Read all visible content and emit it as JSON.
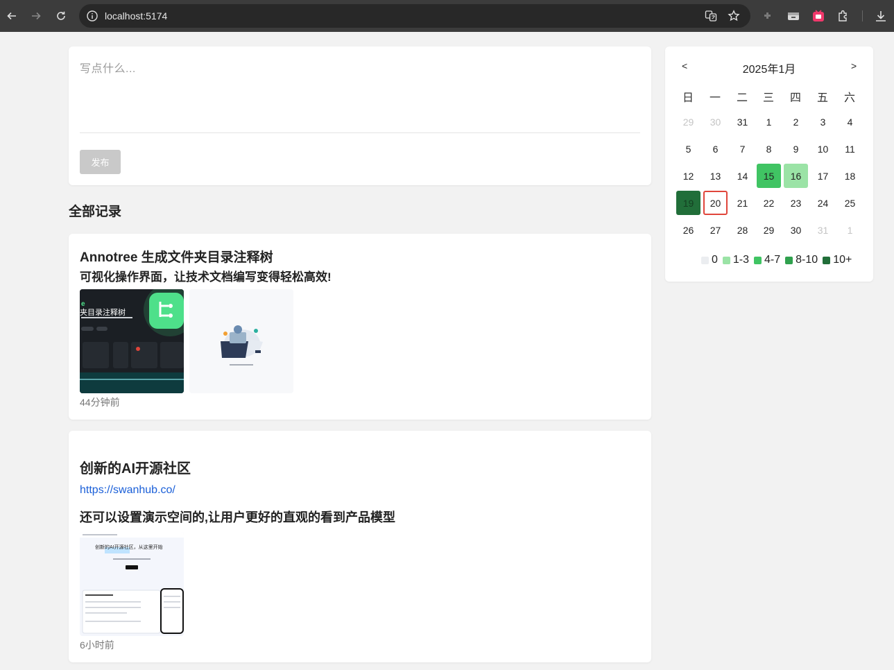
{
  "browser": {
    "url": "localhost:5174"
  },
  "composer": {
    "placeholder": "写点什么...",
    "publish_label": "发布"
  },
  "feed": {
    "section_title": "全部记录",
    "posts": [
      {
        "title": "Annotree 生成文件夹目录注释树",
        "subtitle": "可视化操作界面，让技术文档编写变得轻松高效!",
        "time": "44分钟前",
        "thumb1_text": "夹目录注释树"
      },
      {
        "title": "创新的AI开源社区",
        "link": "https://swanhub.co/",
        "subtitle": "还可以设置演示空间的,让用户更好的直观的看到产品模型",
        "time": "6小时前",
        "thumb_text": "创新的AI开源社区，从这里开始"
      }
    ]
  },
  "calendar": {
    "title": "2025年1月",
    "prev": "<",
    "next": ">",
    "weekdays": [
      "日",
      "一",
      "二",
      "三",
      "四",
      "五",
      "六"
    ],
    "weeks": [
      [
        {
          "d": "29",
          "o": true
        },
        {
          "d": "30",
          "o": true
        },
        {
          "d": "31"
        },
        {
          "d": "1"
        },
        {
          "d": "2"
        },
        {
          "d": "3"
        },
        {
          "d": "4"
        }
      ],
      [
        {
          "d": "5"
        },
        {
          "d": "6"
        },
        {
          "d": "7"
        },
        {
          "d": "8"
        },
        {
          "d": "9"
        },
        {
          "d": "10"
        },
        {
          "d": "11"
        }
      ],
      [
        {
          "d": "12"
        },
        {
          "d": "13"
        },
        {
          "d": "14"
        },
        {
          "d": "15",
          "lvl": 2
        },
        {
          "d": "16",
          "lvl": 1
        },
        {
          "d": "17"
        },
        {
          "d": "18"
        }
      ],
      [
        {
          "d": "19",
          "lvl": 4
        },
        {
          "d": "20",
          "today": true
        },
        {
          "d": "21"
        },
        {
          "d": "22"
        },
        {
          "d": "23"
        },
        {
          "d": "24"
        },
        {
          "d": "25"
        }
      ],
      [
        {
          "d": "26"
        },
        {
          "d": "27"
        },
        {
          "d": "28"
        },
        {
          "d": "29"
        },
        {
          "d": "30"
        },
        {
          "d": "31",
          "o": true
        },
        {
          "d": "1",
          "o": true
        }
      ]
    ],
    "legend": [
      {
        "label": "0",
        "color": "#ebedf0"
      },
      {
        "label": "1-3",
        "color": "#9be3a6"
      },
      {
        "label": "4-7",
        "color": "#40c463"
      },
      {
        "label": "8-10",
        "color": "#30a14e"
      },
      {
        "label": "10+",
        "color": "#216e39"
      }
    ]
  }
}
